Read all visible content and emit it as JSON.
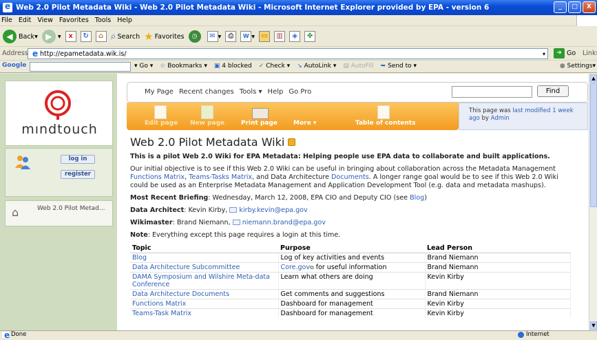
{
  "window": {
    "title": "Web 2.0 Pilot Metadata Wiki - Web 2.0 Pilot Metadata Wiki - Microsoft Internet Explorer provided by EPA - version 6",
    "minimize": "_",
    "maximize": "□",
    "close": "X"
  },
  "menu": [
    "File",
    "Edit",
    "View",
    "Favorites",
    "Tools",
    "Help"
  ],
  "toolbar": {
    "back": "Back",
    "search": "Search",
    "favorites": "Favorites"
  },
  "address": {
    "label": "Address",
    "url": "http://epametadata.wik.is/",
    "go": "Go",
    "links": "Links"
  },
  "google": {
    "logo": "Google",
    "go": "Go",
    "bookmarks": "Bookmarks",
    "blocked": "4 blocked",
    "check": "Check",
    "autolink": "AutoLink",
    "autofill": "AutoFill",
    "sendto": "Send to",
    "settings": "Settings"
  },
  "sidebar": {
    "logo_text": "mındtouch",
    "login": "log in",
    "register": "register",
    "nav_item": "Web 2.0 Pilot Metad..."
  },
  "topnav": {
    "links": [
      "My Page",
      "Recent changes",
      "Tools ▾",
      "Help",
      "Go Pro"
    ],
    "find": "Find"
  },
  "actions": [
    {
      "label": "Edit page",
      "dim": true
    },
    {
      "label": "New page",
      "dim": true
    },
    {
      "label": "Print page",
      "dim": false
    },
    {
      "label": "More ▾",
      "dim": false
    },
    {
      "label": "Table of contents",
      "dim": false
    }
  ],
  "modified": {
    "text1": "This page was ",
    "link1": "last modified 1 week ago",
    "text2": " by ",
    "link2": "Admin"
  },
  "page": {
    "title": "Web 2.0 Pilot Metadata Wiki",
    "intro": "This is a pilot Web 2.0 Wiki for EPA Metadata: Helping people use EPA data to collaborate and built applications.",
    "objective_a": "Our initial objective is to see if this Web 2.0 Wiki can be useful in bringing about collaboration across the Metadata Management ",
    "objective_link1": "Functions Matrix",
    "objective_b": ", ",
    "objective_link2": "Teams-Tasks Matrix",
    "objective_c": ", and Data Architecture ",
    "objective_link3": "Documents",
    "objective_d": ". A longer range goal would be to see if this Web 2.0 Wiki could be used as an Enterprise Metadata Management and Application Development Tool (e.g. data and metadata mashups).",
    "briefing_label": "Most Recent Briefing",
    "briefing_text": ": Wednesday, March 12, 2008, EPA CIO and Deputy CIO (see ",
    "briefing_link": "Blog",
    "briefing_end": ")",
    "architect_label": "Data Architect",
    "architect_text": ": Kevin Kirby, ",
    "architect_email": "kirby.kevin@epa.gov",
    "wikimaster_label": "Wikimaster",
    "wikimaster_text": ": Brand Niemann, ",
    "wikimaster_email": "niemann.brand@epa.gov",
    "note_label": "Note",
    "note_text": ": Everything except this page requires a login at this time."
  },
  "table": {
    "headers": [
      "Topic",
      "Purpose",
      "Lead Person"
    ],
    "rows": [
      {
        "topic": "Blog",
        "purpose": "Log of key activities and events",
        "purpose_link": "",
        "lead": "Brand Niemann"
      },
      {
        "topic": "Data Architecture Subcommittee",
        "purpose": " for useful information",
        "purpose_link": "Core.gov",
        "lead": "Brand Niemann"
      },
      {
        "topic": "DAMA Symposium and Wilshire Meta-data Conference",
        "purpose": "Learn what others are doing",
        "purpose_link": "",
        "lead": "Kevin Kirby"
      },
      {
        "topic": "Data Architecture Documents",
        "purpose": "Get comments and suggestions",
        "purpose_link": "",
        "lead": "Brand Niemann"
      },
      {
        "topic": "Functions Matrix",
        "purpose": "Dashboard for management",
        "purpose_link": "",
        "lead": "Kevin Kirby"
      },
      {
        "topic": "Teams-Task Matrix",
        "purpose": "Dashboard for management",
        "purpose_link": "",
        "lead": "Kevin Kirby"
      }
    ]
  },
  "status": {
    "left": "Done",
    "zone": "Internet"
  }
}
